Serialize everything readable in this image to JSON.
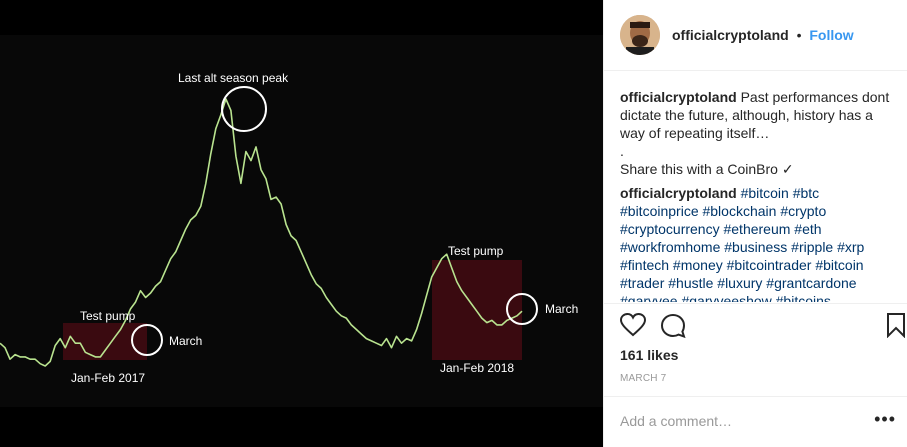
{
  "post": {
    "username": "officialcryptoland",
    "follow_label": "Follow",
    "separator": "•"
  },
  "chart_data": {
    "type": "line",
    "title": "",
    "xlabel": "",
    "ylabel": "",
    "x": [
      0,
      1,
      2,
      3,
      4,
      5,
      6,
      7,
      8,
      9,
      10,
      11,
      12,
      13,
      14,
      15,
      16,
      17,
      18,
      19,
      20,
      21,
      22,
      23,
      24,
      25,
      26,
      27,
      28,
      29,
      30,
      31,
      32,
      33,
      34,
      35,
      36,
      37,
      38,
      39,
      40,
      41,
      42,
      43,
      44,
      45,
      46,
      47,
      48,
      49,
      50,
      51,
      52,
      53,
      54,
      55,
      56,
      57,
      58,
      59,
      60,
      61,
      62,
      63,
      64,
      65,
      66,
      67,
      68,
      69,
      70,
      71,
      72,
      73,
      74,
      75,
      76,
      77,
      78,
      79,
      80,
      81,
      82,
      83,
      84,
      85,
      86,
      87,
      88,
      89,
      90,
      91,
      92,
      93,
      94,
      95,
      96,
      97,
      98,
      99,
      100,
      101,
      102,
      103,
      104
    ],
    "series": [
      {
        "values": [
          10,
          8,
          3,
          5,
          4,
          4,
          3,
          3,
          1,
          0,
          2,
          9,
          12,
          8,
          13,
          10,
          10,
          6,
          5,
          4,
          4,
          7,
          10,
          13,
          16,
          20,
          25,
          28,
          33,
          30,
          32,
          35,
          37,
          42,
          47,
          50,
          55,
          60,
          64,
          66,
          70,
          80,
          93,
          104,
          110,
          117,
          112,
          92,
          80,
          94,
          90,
          96,
          86,
          82,
          73,
          74,
          71,
          62,
          57,
          55,
          50,
          45,
          40,
          36,
          34,
          30,
          27,
          24,
          22,
          21,
          18,
          16,
          14,
          12,
          11,
          10,
          9,
          12,
          8,
          13,
          10,
          12,
          11,
          16,
          23,
          31,
          39,
          43,
          47,
          49,
          43,
          37,
          33,
          30,
          27,
          24,
          21,
          19,
          20,
          18,
          18,
          20,
          21,
          22,
          24
        ]
      }
    ],
    "annotations": [
      {
        "text": "Last alt season peak"
      },
      {
        "text": "Test pump"
      },
      {
        "text": "March"
      },
      {
        "text": "Jan-Feb 2017"
      },
      {
        "text": "Test pump"
      },
      {
        "text": "March"
      },
      {
        "text": "Jan-Feb 2018"
      }
    ],
    "line_color": "#b9e38f",
    "highlight_color": "#3a0a10",
    "circle_color": "#ffffff"
  },
  "caption": {
    "lines": [
      "Past performances dont dictate the future, although, history has a way of repeating itself…",
      ".",
      "Share this with a CoinBro ✓"
    ]
  },
  "hashtags_text": "#bitcoin #btc #bitcoinprice #blockchain #crypto #cryptocurrency #ethereum #eth #workfromhome #business #ripple #xrp #fintech #money #bitcointrader #bitcoin #trader #hustle #luxury #grantcardone #garyvee #garyveeshow #bitcoins",
  "likes": "161 likes",
  "date": "MARCH 7",
  "comment_input": {
    "placeholder": "Add a comment…",
    "value": ""
  },
  "more_label": "•••",
  "icons": {
    "like": "heart-icon",
    "comment": "comment-icon",
    "save": "bookmark-icon",
    "more": "more-options-icon"
  }
}
